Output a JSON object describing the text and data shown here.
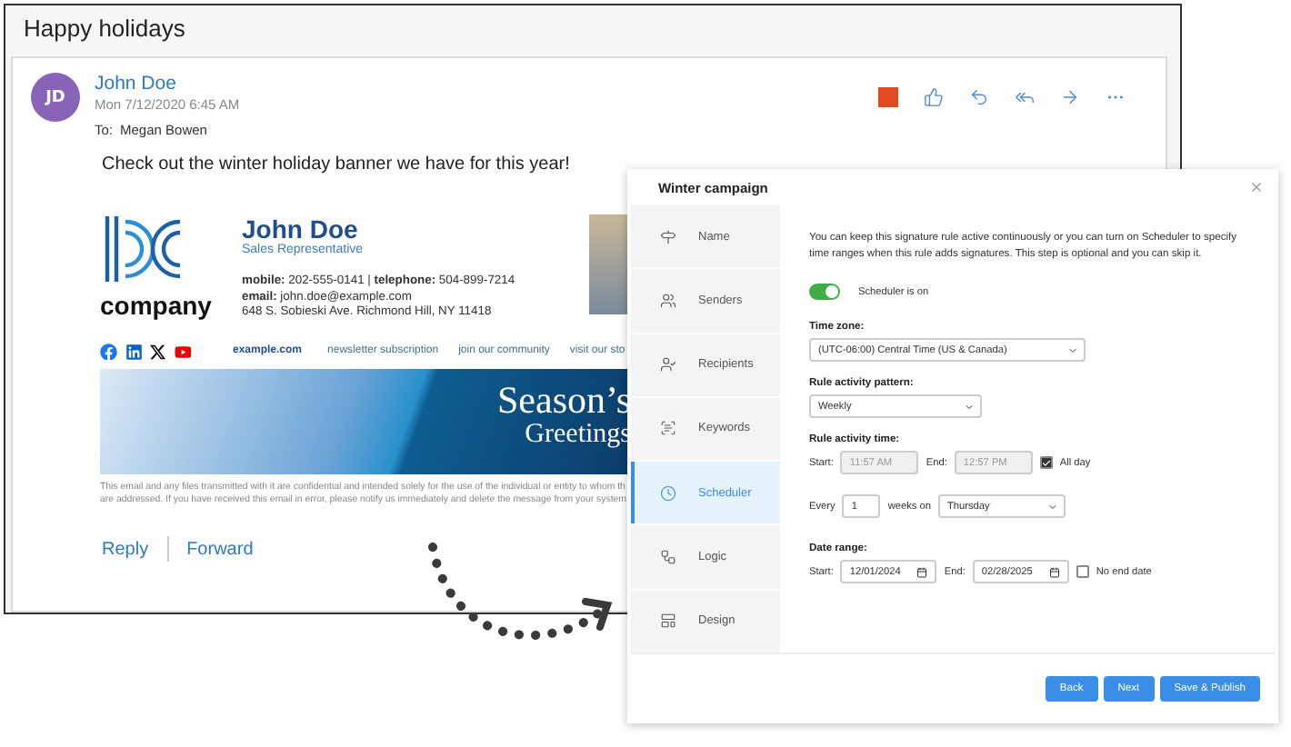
{
  "email": {
    "subject": "Happy holidays",
    "sender": {
      "initials": "JD",
      "name": "John Doe",
      "date": "Mon 7/12/2020 6:45 AM"
    },
    "to_label": "To:",
    "recipient": "Megan Bowen",
    "body": "Check out the winter holiday banner we have for this year!",
    "signature": {
      "company": "company",
      "name": "John Doe",
      "title": "Sales Representative",
      "contacts": [
        "**mobile:** 202-555-0141  |  **telephone:** 504-899-7214",
        "**email:** john.doe@example.com",
        "648 S. Sobieski Ave. Richmond Hill, NY 11418"
      ],
      "links": [
        {
          "label": "example.com",
          "kind": "website"
        },
        {
          "label": "newsletter subscription",
          "kind": "link"
        },
        {
          "label": "join our community",
          "kind": "link"
        },
        {
          "label": "visit our sto",
          "kind": "link"
        }
      ],
      "banner": {
        "line_1": "Season’s",
        "line_2": "Greetings"
      },
      "disclaimer": [
        "This email and any files transmitted with it are confidential and intended solely for the use of the individual or entity to whom th",
        "are addressed. If you have received this email in error, please notify us immediately and delete the message from your system"
      ]
    },
    "actions": [
      "Reply",
      "Forward"
    ]
  },
  "dialog": {
    "title": "Winter campaign",
    "steps": [
      {
        "label": "Name",
        "selected": false
      },
      {
        "label": "Senders",
        "selected": false
      },
      {
        "label": "Recipients",
        "selected": false
      },
      {
        "label": "Keywords",
        "selected": false
      },
      {
        "label": "Scheduler",
        "selected": true
      },
      {
        "label": "Logic",
        "selected": false
      },
      {
        "label": "Design",
        "selected": false
      }
    ],
    "intro": "You can keep this signature rule active continuously or you can turn on Scheduler to specify time ranges when this rule adds signatures. This step is optional and you can skip it.",
    "scheduler_toggle": {
      "label": "Scheduler is on",
      "on": true
    },
    "time_zone": {
      "label": "Time zone:",
      "value": "(UTC-06:00) Central Time (US & Canada)"
    },
    "pattern": {
      "label": "Rule activity pattern:",
      "value": "Weekly"
    },
    "activity_time": {
      "label": "Rule activity time:",
      "start_label": "Start:",
      "start": "11:57 AM",
      "end_label": "End:",
      "end": "12:57 PM",
      "disabled": true,
      "all_day": {
        "label": "All day",
        "checked": true
      }
    },
    "recurrence": {
      "prefix": "Every",
      "count": "1",
      "middle": "weeks on",
      "day": "Thursday"
    },
    "date_range": {
      "label": "Date range:",
      "start_label": "Start:",
      "start": "12/01/2024",
      "end_label": "End:",
      "end": "02/28/2025",
      "no_end": {
        "label": "No end date",
        "checked": false
      }
    },
    "buttons": [
      "Back",
      "Next",
      "Save & Publish"
    ]
  }
}
